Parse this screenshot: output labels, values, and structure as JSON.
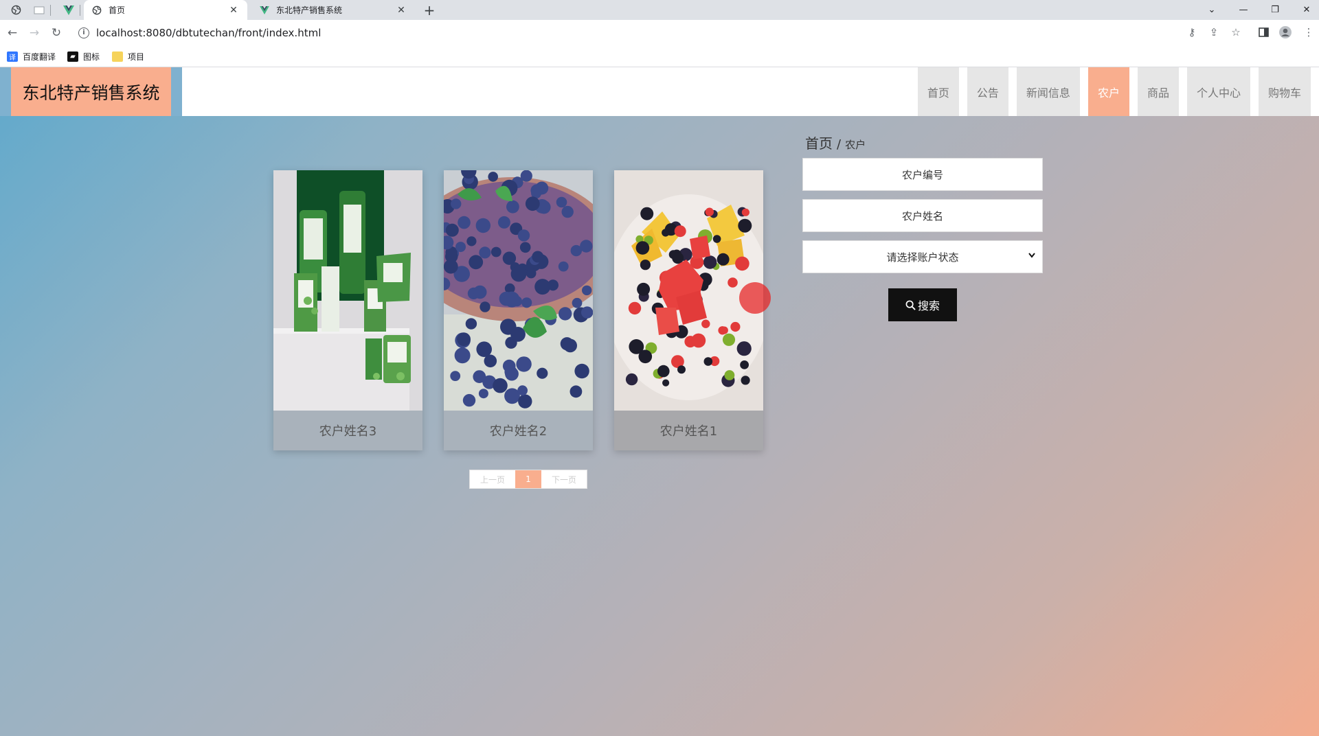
{
  "browser": {
    "tabs": [
      {
        "title": "首页",
        "active": true
      },
      {
        "title": "东北特产销售系统",
        "active": false
      }
    ],
    "url": "localhost:8080/dbtutechan/front/index.html",
    "bookmarks": [
      "百度翻译",
      "图标",
      "项目"
    ]
  },
  "site": {
    "logo": "东北特产销售系统",
    "nav": [
      "首页",
      "公告",
      "新闻信息",
      "农户",
      "商品",
      "个人中心",
      "购物车"
    ],
    "active_nav": "农户"
  },
  "breadcrumb": {
    "home": "首页",
    "separator": "/",
    "current": "农户"
  },
  "farmers": [
    {
      "name": "农户姓名3",
      "image": "green-packaged-products"
    },
    {
      "name": "农户姓名2",
      "image": "blueberries"
    },
    {
      "name": "农户姓名1",
      "image": "fruit-platter"
    }
  ],
  "pagination": {
    "prev": "上一页",
    "current": "1",
    "next": "下一页"
  },
  "search": {
    "number_placeholder": "农户编号",
    "name_placeholder": "农户姓名",
    "status_placeholder": "请选择账户状态",
    "button_label": "搜索"
  },
  "colors": {
    "accent": "#f9ae8e",
    "logo_bg": "#7fb1cf",
    "button": "#111111"
  }
}
